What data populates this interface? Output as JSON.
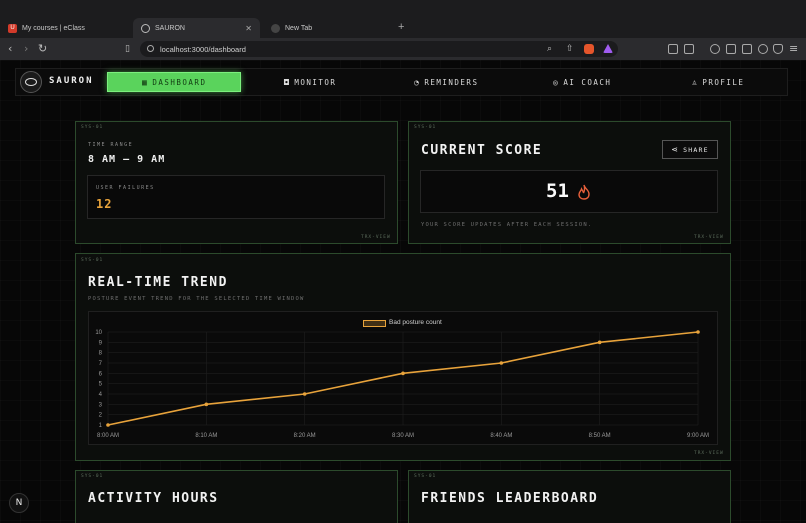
{
  "browser": {
    "tabs": [
      {
        "title": "My courses | eClass",
        "icon": "u-app-icon"
      },
      {
        "title": "SAURON",
        "icon": "globe-icon"
      },
      {
        "title": "New Tab",
        "icon": "brave-icon"
      }
    ],
    "url": "localhost:3000/dashboard"
  },
  "nav": {
    "brand": "SAURON",
    "items": [
      {
        "label": "DASHBOARD",
        "icon": "grid-icon",
        "active": true
      },
      {
        "label": "MONITOR",
        "icon": "camera-icon"
      },
      {
        "label": "REMINDERS",
        "icon": "bell-icon"
      },
      {
        "label": "AI COACH",
        "icon": "sparkle-icon"
      },
      {
        "label": "PROFILE",
        "icon": "user-icon"
      }
    ]
  },
  "time_card": {
    "sys": "SYS-01",
    "label": "TIME RANGE",
    "value": "8 AM – 9 AM",
    "failures_label": "USER FAILURES",
    "failures_value": "12",
    "footer": "TRX-VIEW"
  },
  "score_card": {
    "sys": "SYS-01",
    "title": "CURRENT SCORE",
    "share": "SHARE",
    "score": "51",
    "note": "YOUR SCORE UPDATES AFTER EACH SESSION.",
    "footer": "TRX-VIEW"
  },
  "trend_card": {
    "sys": "SYS-01",
    "title": "REAL-TIME TREND",
    "subtitle": "POSTURE EVENT TREND FOR THE SELECTED TIME WINDOW",
    "footer": "TRX-VIEW"
  },
  "chart_data": {
    "type": "line",
    "x": [
      "8:00 AM",
      "8:10 AM",
      "8:20 AM",
      "8:30 AM",
      "8:40 AM",
      "8:50 AM",
      "9:00 AM"
    ],
    "series": [
      {
        "name": "Bad posture count",
        "values": [
          1,
          3,
          4,
          6,
          7,
          9,
          10
        ],
        "color": "#e8a33b"
      }
    ],
    "ylim": [
      1,
      10
    ],
    "yticks": [
      "1",
      "2",
      "3",
      "4",
      "5",
      "6",
      "7",
      "8",
      "9",
      "10"
    ],
    "grid": true,
    "legend": "top-center"
  },
  "activity_card": {
    "sys": "SYS-01",
    "title": "ACTIVITY HOURS"
  },
  "leaderboard_card": {
    "sys": "SYS-01",
    "title": "FRIENDS LEADERBOARD"
  },
  "badge": "N"
}
